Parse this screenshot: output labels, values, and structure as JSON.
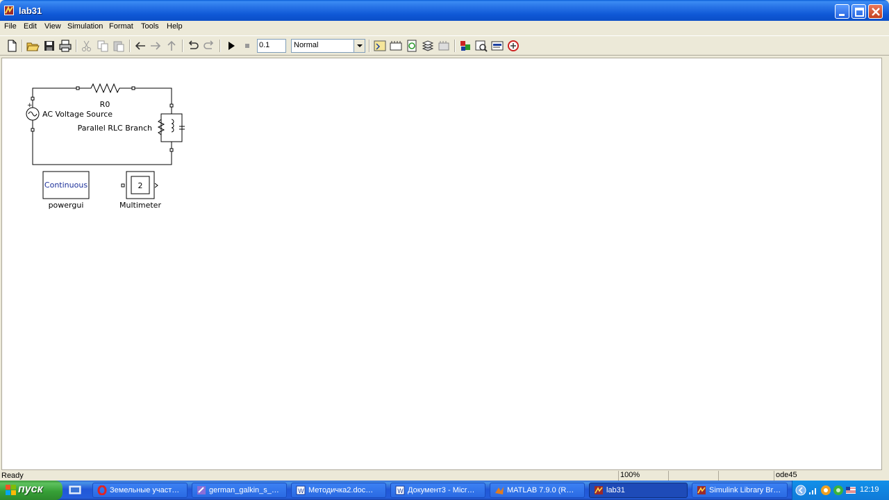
{
  "window": {
    "title": "lab31"
  },
  "menu": [
    "File",
    "Edit",
    "View",
    "Simulation",
    "Format",
    "Tools",
    "Help"
  ],
  "toolbar": {
    "stop_time": "0.1",
    "sim_mode": "Normal",
    "icons": [
      "new-model",
      "open",
      "save",
      "print",
      "cut",
      "copy",
      "paste",
      "back",
      "forward",
      "up",
      "undo",
      "redo",
      "start-simulation",
      "stop-simulation",
      "build",
      "update-diagram",
      "refresh",
      "library-browser",
      "model-explorer",
      "debugger",
      "model-advisor",
      "profile",
      "hide-browser",
      "no-entry"
    ]
  },
  "diagram": {
    "blocks": [
      {
        "id": "r0",
        "label": "R0"
      },
      {
        "id": "ac_source",
        "label": "AC Voltage Source"
      },
      {
        "id": "rlc",
        "label": "Parallel RLC Branch"
      },
      {
        "id": "powergui",
        "label": "powergui",
        "inner_text": "Continuous"
      },
      {
        "id": "multimeter",
        "label": "Multimeter",
        "inner_text": "2"
      }
    ],
    "ac_plus_sign": "+"
  },
  "status": {
    "text": "Ready",
    "zoom": "100%",
    "solver": "ode45"
  },
  "taskbar": {
    "start_label": "пуск",
    "tasks": [
      {
        "label": "Земельные участ…",
        "icon_color": "#d42a2a"
      },
      {
        "label": "german_galkin_s_…",
        "icon_color": "#8b6fd8"
      },
      {
        "label": "Методичка2.doc…",
        "icon_color": "#ffffff"
      },
      {
        "label": "Документ3 - Micr…",
        "icon_color": "#ffffff"
      },
      {
        "label": "MATLAB  7.9.0 (R…",
        "icon_color": "#e07b20"
      },
      {
        "label": "lab31",
        "icon_color": "#2a6ae3",
        "active": true
      },
      {
        "label": "Simulink Library Br…",
        "icon_color": "#2a6ae3"
      }
    ],
    "clock": "12:19"
  }
}
